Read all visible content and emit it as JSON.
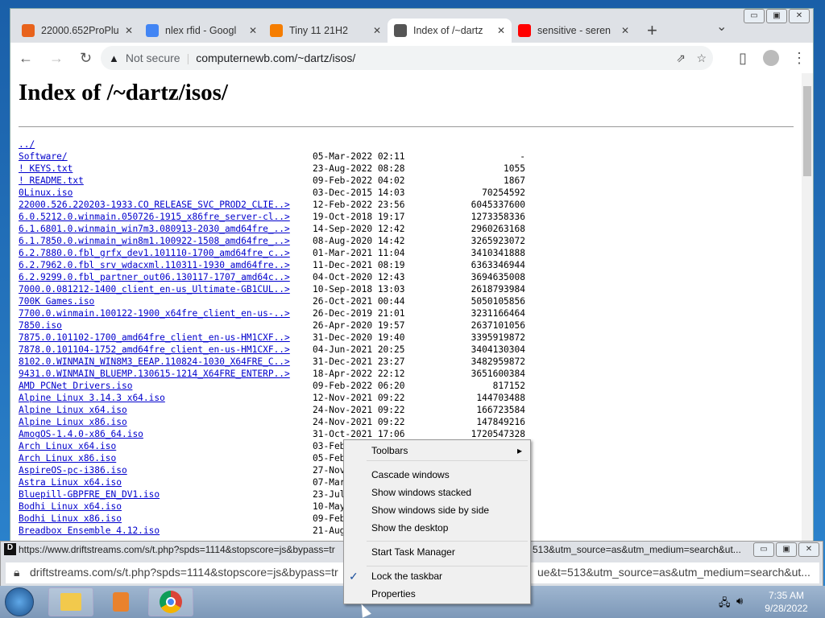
{
  "browser": {
    "tabs": [
      {
        "label": "22000.652ProPlu",
        "icon": "tiny-icon",
        "color": "#e8631c"
      },
      {
        "label": "nlex rfid - Googl",
        "icon": "google-icon",
        "color": "#4285f4"
      },
      {
        "label": "Tiny 11 21H2",
        "icon": "blogger-icon",
        "color": "#f57d00"
      },
      {
        "label": "Index of /~dartz",
        "icon": "globe-icon",
        "color": "#555555",
        "active": true
      },
      {
        "label": "sensitive - seren",
        "icon": "youtube-icon",
        "color": "#ff0000"
      }
    ],
    "security": "Not secure",
    "url": "computernewb.com/~dartz/isos/"
  },
  "page": {
    "title": "Index of /~dartz/isos/",
    "entries": [
      {
        "name": "../",
        "date": "",
        "size": ""
      },
      {
        "name": "Software/",
        "date": "05-Mar-2022 02:11",
        "size": "-"
      },
      {
        "name": "! KEYS.txt",
        "date": "23-Aug-2022 08:28",
        "size": "1055"
      },
      {
        "name": "! README.txt",
        "date": "09-Feb-2022 04:02",
        "size": "1867"
      },
      {
        "name": "0Linux.iso",
        "date": "03-Dec-2015 14:03",
        "size": "70254592"
      },
      {
        "name": "22000.526.220203-1933.CO_RELEASE_SVC_PROD2_CLIE..>",
        "date": "12-Feb-2022 23:56",
        "size": "6045337600"
      },
      {
        "name": "6.0.5212.0.winmain.050726-1915_x86fre_server-cl..>",
        "date": "19-Oct-2018 19:17",
        "size": "1273358336"
      },
      {
        "name": "6.1.6801.0.winmain_win7m3.080913-2030_amd64fre_..>",
        "date": "14-Sep-2020 12:42",
        "size": "2960263168"
      },
      {
        "name": "6.1.7850.0.winmain_win8m1.100922-1508_amd64fre_..>",
        "date": "08-Aug-2020 14:42",
        "size": "3265923072"
      },
      {
        "name": "6.2.7880.0.fbl_grfx_dev1.101110-1700_amd64fre_c..>",
        "date": "01-Mar-2021 11:04",
        "size": "3410341888"
      },
      {
        "name": "6.2.7962.0.fbl_srv_wdacxml.110311-1930_amd64fre..>",
        "date": "11-Dec-2021 08:19",
        "size": "6363346944"
      },
      {
        "name": "6.2.9299.0.fbl_partner_out06.130117-1707_amd64c..>",
        "date": "04-Oct-2020 12:43",
        "size": "3694635008"
      },
      {
        "name": "7000.0.081212-1400_client_en-us_Ultimate-GB1CUL..>",
        "date": "10-Sep-2018 13:03",
        "size": "2618793984"
      },
      {
        "name": "700K Games.iso",
        "date": "26-Oct-2021 00:44",
        "size": "5050105856"
      },
      {
        "name": "7700.0.winmain.100122-1900_x64fre_client_en-us-..>",
        "date": "26-Dec-2019 21:01",
        "size": "3231166464"
      },
      {
        "name": "7850.iso",
        "date": "26-Apr-2020 19:57",
        "size": "2637101056"
      },
      {
        "name": "7875.0.101102-1700_amd64fre_client_en-us-HM1CXF..>",
        "date": "31-Dec-2020 19:40",
        "size": "3395919872"
      },
      {
        "name": "7878.0.101104-1752_amd64fre_client_en-us-HM1CXF..>",
        "date": "04-Jun-2021 20:25",
        "size": "3404130304"
      },
      {
        "name": "8102.0.WINMAIN_WIN8M3_EEAP.110824-1030_X64FRE_C..>",
        "date": "31-Dec-2021 23:27",
        "size": "3482959872"
      },
      {
        "name": "9431.0.WINMAIN_BLUEMP.130615-1214_X64FRE_ENTERP..>",
        "date": "18-Apr-2022 22:12",
        "size": "3651600384"
      },
      {
        "name": "AMD PCNet Drivers.iso",
        "date": "09-Feb-2022 06:20",
        "size": "817152"
      },
      {
        "name": "Alpine Linux 3.14.3 x64.iso",
        "date": "12-Nov-2021 09:22",
        "size": "144703488"
      },
      {
        "name": "Alpine Linux x64.iso",
        "date": "24-Nov-2021 09:22",
        "size": "166723584"
      },
      {
        "name": "Alpine Linux x86.iso",
        "date": "24-Nov-2021 09:22",
        "size": "147849216"
      },
      {
        "name": "AmogOS-1.4.0-x86_64.iso",
        "date": "31-Oct-2021 17:06",
        "size": "1720547328"
      },
      {
        "name": "Arch Linux x64.iso",
        "date": "03-Feb",
        "size": ""
      },
      {
        "name": "Arch Linux x86.iso",
        "date": "05-Feb",
        "size": ""
      },
      {
        "name": "AspireOS-pc-i386.iso",
        "date": "27-Nov",
        "size": ""
      },
      {
        "name": "Astra Linux x64.iso",
        "date": "07-Mar",
        "size": ""
      },
      {
        "name": "Bluepill-GBPFRE_EN_DV1.iso",
        "date": "23-Jul",
        "size": ""
      },
      {
        "name": "Bodhi Linux x64.iso",
        "date": "10-May",
        "size": ""
      },
      {
        "name": "Bodhi Linux x86.iso",
        "date": "09-Feb",
        "size": ""
      },
      {
        "name": "Breadbox Ensemble 4.12.iso",
        "date": "21-Aug",
        "size": ""
      }
    ]
  },
  "popup": {
    "title_left": "https://www.driftstreams.com/s/t.php?spds=1114&stopscore=js&bypass=tr",
    "title_right": "513&utm_source=as&utm_medium=search&ut...",
    "url_left": "driftstreams.com/s/t.php?spds=1114&stopscore=js&bypass=tr",
    "url_right": "ue&t=513&utm_source=as&utm_medium=search&ut..."
  },
  "context_menu": {
    "items": [
      "Toolbars",
      "Cascade windows",
      "Show windows stacked",
      "Show windows side by side",
      "Show the desktop",
      "Start Task Manager",
      "Lock the taskbar",
      "Properties"
    ],
    "checked": "Lock the taskbar"
  },
  "clock": {
    "time": "7:35 AM",
    "date": "9/28/2022"
  }
}
